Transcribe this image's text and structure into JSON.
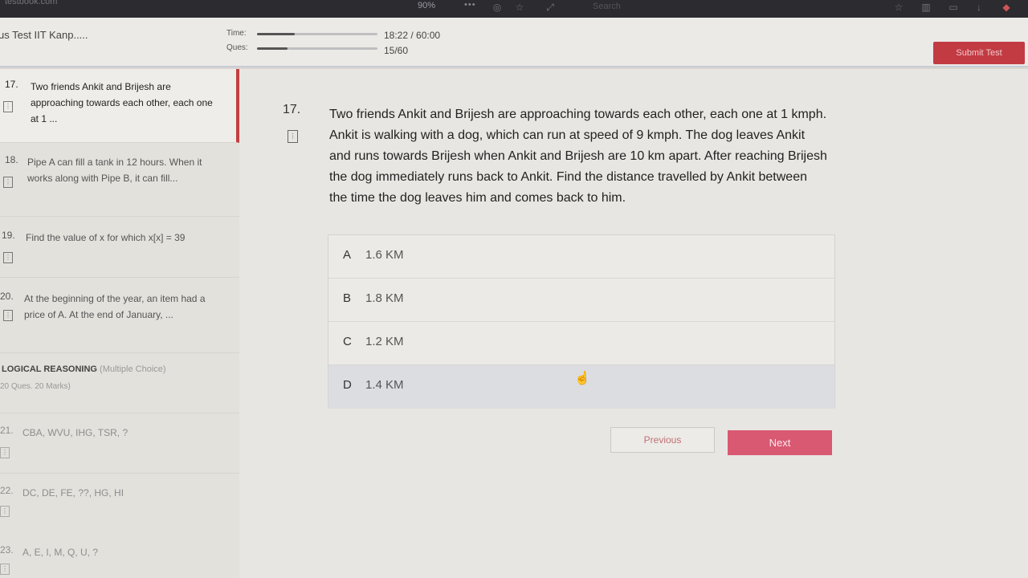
{
  "browser": {
    "url": "testbook.com",
    "zoom": "90%",
    "menu": "•••",
    "search_placeholder": "Search"
  },
  "header": {
    "test_title": "us Test IIT Kanp.....",
    "time_label": "Time:",
    "time_value": "18:22 / 60:00",
    "time_progress": 0.31,
    "ques_label": "Ques:",
    "ques_value": "15/60",
    "ques_progress": 0.25,
    "submit_label": "Submit Test"
  },
  "sidebar": {
    "items": [
      {
        "num": "17.",
        "text": "Two friends Ankit and Brijesh are approaching towards each other, each one at 1 ..."
      },
      {
        "num": "18.",
        "text": "Pipe A can fill a tank in 12 hours. When it works along with Pipe B, it can fill..."
      },
      {
        "num": "19.",
        "text": "Find the value of x for which x[x] = 39"
      },
      {
        "num": "20.",
        "text": "At the beginning of the year, an item had a price of A. At the end of January, ..."
      }
    ],
    "section": {
      "title": "LOGICAL REASONING",
      "type": "(Multiple Choice)",
      "marks": "20 Ques. 20 Marks)"
    },
    "lr_items": [
      {
        "num": "21.",
        "text": "CBA, WVU, IHG, TSR, ?"
      },
      {
        "num": "22.",
        "text": "DC, DE, FE, ??, HG, HI"
      },
      {
        "num": "23.",
        "text": "A, E, I, M, Q, U, ?"
      }
    ]
  },
  "question": {
    "number": "17.",
    "text": "Two friends Ankit and Brijesh are approaching towards each other, each one at 1 kmph. Ankit is walking with a dog, which can run at speed of 9 kmph. The dog leaves Ankit and runs towards Brijesh when Ankit and Brijesh are 10 km apart. After reaching Brijesh the dog immediately runs back to Ankit. Find the distance travelled by Ankit between the time the dog leaves him and comes back to him.",
    "options": [
      {
        "letter": "A",
        "text": "1.6 KM"
      },
      {
        "letter": "B",
        "text": "1.8 KM"
      },
      {
        "letter": "C",
        "text": "1.2 KM"
      },
      {
        "letter": "D",
        "text": "1.4 KM"
      }
    ]
  },
  "nav": {
    "previous_label": "Previous",
    "next_label": "Next"
  },
  "colors": {
    "submit": "#c23b43",
    "next": "#d95872",
    "active_marker": "#c24040"
  }
}
